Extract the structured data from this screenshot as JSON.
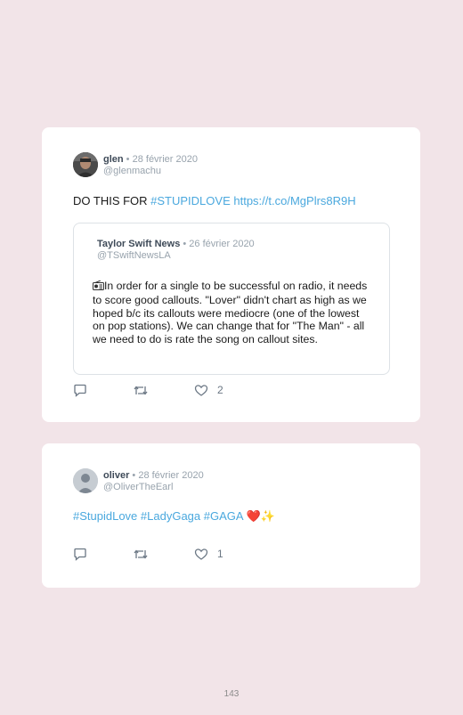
{
  "tweets": [
    {
      "author": "glen",
      "date": "28 février 2020",
      "handle": "@glenmachu",
      "text_plain": "DO THIS FOR ",
      "hashtag": "#STUPIDLOVE",
      "url": "https://t.co/MgPlrs8R9H",
      "likes": "2",
      "quoted": {
        "author": "Taylor Swift News",
        "date": "26 février 2020",
        "handle": "@TSwiftNewsLA",
        "text": "In order for a single to be successful on radio, it needs to score good callouts. \"Lover\" didn't chart as high as we hoped b/c its callouts were mediocre (one of the lowest on pop stations). We can change that for \"The Man\" - all we need to do is rate the song on callout sites."
      }
    },
    {
      "author": "oliver",
      "date": "28 février 2020",
      "handle": "@OliverTheEarl",
      "hashtags": [
        "#StupidLove",
        "#LadyGaga",
        "#GAGA"
      ],
      "emoji": "❤️✨",
      "likes": "1"
    }
  ],
  "separator": " • ",
  "page_number": "143",
  "icons": {
    "reply": "reply-icon",
    "retweet": "retweet-icon",
    "like": "heart-outline-icon",
    "quote_media": "radio-icon"
  },
  "colors": {
    "background": "#f2e4e8",
    "card": "#ffffff",
    "link": "#4aa8de",
    "name": "#3e4a58",
    "muted": "#98a3ad"
  }
}
